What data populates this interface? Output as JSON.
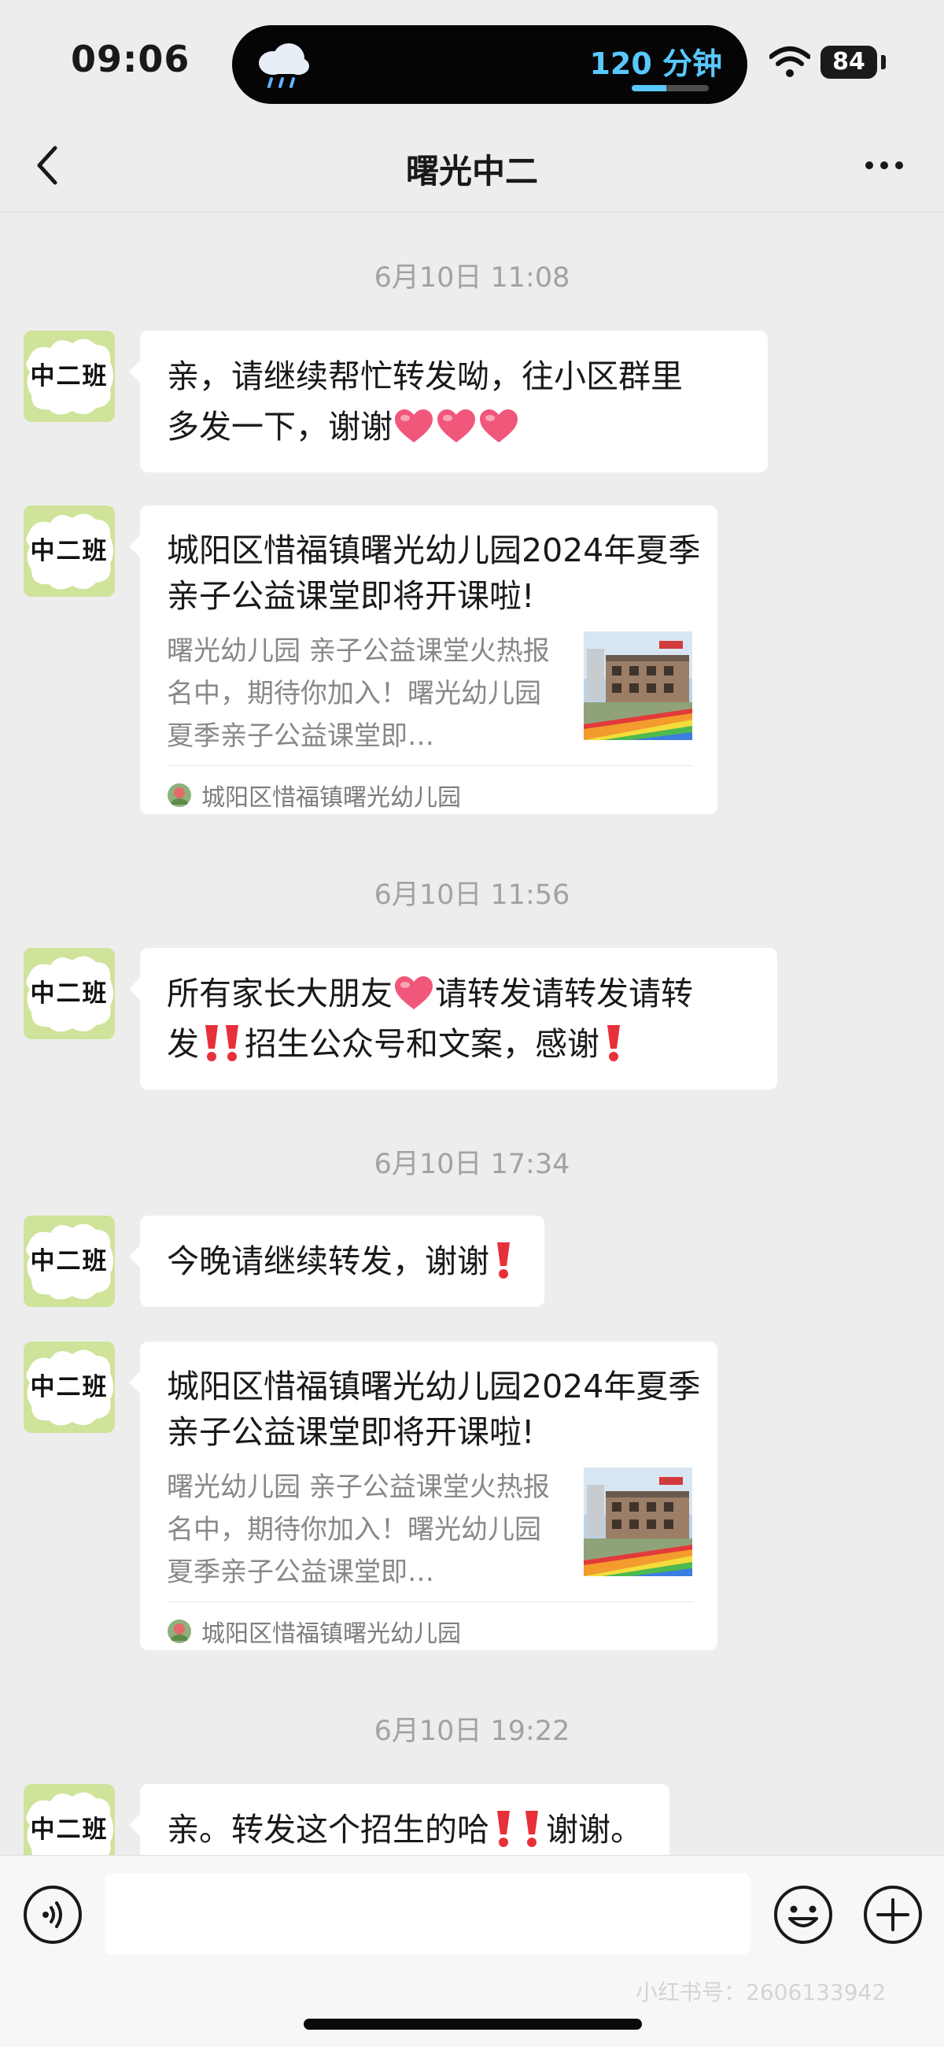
{
  "status_bar": {
    "time": "09:06",
    "island_label": "120 分钟",
    "island_progress": 0.45,
    "battery": "84"
  },
  "header": {
    "title": "曙光中二",
    "back_icon": "chevron-left-icon",
    "more_icon": "more-dots-icon"
  },
  "chat": {
    "avatar_label": "中二班",
    "items": [
      {
        "type": "time",
        "text": "6月10日 11:08"
      },
      {
        "type": "text",
        "parts": [
          "亲，请继续帮忙转发呦，往小区群里",
          "多发一下，谢谢"
        ],
        "emoji": [
          "heart",
          "heart",
          "heart"
        ]
      },
      {
        "type": "link",
        "title": "城阳区惜福镇曙光幼儿园2024年夏季亲子公益课堂即将开课啦!",
        "desc": "曙光幼儿园 亲子公益课堂火热报名中，期待你加入！曙光幼儿园夏季亲子公益课堂即…",
        "source": "城阳区惜福镇曙光幼儿园"
      },
      {
        "type": "time",
        "text": "6月10日 11:56"
      },
      {
        "type": "text",
        "parts": [
          "所有家长大朋友",
          "请转发请转发请转",
          "发",
          "招生公众号和文案，感谢"
        ],
        "emoji": [
          "heart",
          "double-exclamation",
          "exclamation"
        ]
      },
      {
        "type": "time",
        "text": "6月10日 17:34"
      },
      {
        "type": "text",
        "parts": [
          "今晚请继续转发，谢谢"
        ],
        "emoji": [
          "exclamation"
        ]
      },
      {
        "type": "link",
        "title": "城阳区惜福镇曙光幼儿园2024年夏季亲子公益课堂即将开课啦!",
        "desc": "曙光幼儿园 亲子公益课堂火热报名中，期待你加入！曙光幼儿园夏季亲子公益课堂即…",
        "source": "城阳区惜福镇曙光幼儿园"
      },
      {
        "type": "time",
        "text": "6月10日 19:22"
      },
      {
        "type": "text",
        "parts": [
          "亲。转发这个招生的哈",
          "谢谢。"
        ],
        "emoji": [
          "exclamation",
          "exclamation"
        ]
      }
    ]
  },
  "input_bar": {
    "value": "",
    "icons": [
      "voice-icon",
      "emoji-icon",
      "plus-icon"
    ]
  },
  "watermark": "小红书号：2606133942",
  "colors": {
    "background": "#ededed",
    "bubble": "#ffffff",
    "heart": "#f0577a",
    "exclamation": "#e8303a",
    "island_accent": "#58c8ff",
    "timestamp": "#a2a2a2"
  }
}
